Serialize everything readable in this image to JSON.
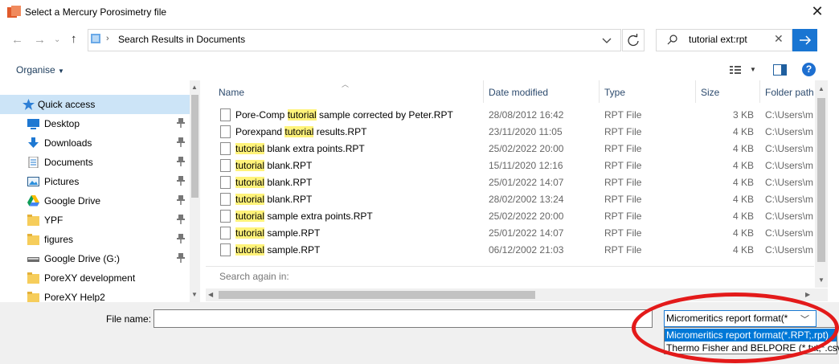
{
  "window": {
    "title": "Select a Mercury Porosimetry file"
  },
  "nav": {
    "address": "Search Results in Documents",
    "search_query": "tutorial ext:rpt"
  },
  "toolbar": {
    "organise_label": "Organise",
    "help": "?"
  },
  "sidebar": {
    "items": [
      {
        "label": "Quick access",
        "icon": "star-icon",
        "pinned": false,
        "selected": true
      },
      {
        "label": "Desktop",
        "icon": "desktop-icon",
        "pinned": true
      },
      {
        "label": "Downloads",
        "icon": "download-icon",
        "pinned": true
      },
      {
        "label": "Documents",
        "icon": "documents-icon",
        "pinned": true
      },
      {
        "label": "Pictures",
        "icon": "pictures-icon",
        "pinned": true
      },
      {
        "label": "Google Drive",
        "icon": "google-drive-icon",
        "pinned": true
      },
      {
        "label": "YPF",
        "icon": "folder-icon",
        "pinned": true
      },
      {
        "label": "figures",
        "icon": "folder-icon",
        "pinned": true
      },
      {
        "label": "Google Drive (G:)",
        "icon": "drive-icon",
        "pinned": true
      },
      {
        "label": "PoreXY development",
        "icon": "folder-icon",
        "pinned": false
      },
      {
        "label": "PoreXY Help2",
        "icon": "folder-icon",
        "pinned": false
      }
    ]
  },
  "file_list": {
    "columns": {
      "name": "Name",
      "date": "Date modified",
      "type": "Type",
      "size": "Size",
      "path": "Folder path"
    },
    "rows": [
      {
        "pre": "Pore-Comp ",
        "hl": "tutorial",
        "post": " sample corrected by Peter.RPT",
        "date": "28/08/2012 16:42",
        "type": "RPT File",
        "size": "3 KB",
        "path": "C:\\Users\\m"
      },
      {
        "pre": "Porexpand ",
        "hl": "tutorial",
        "post": " results.RPT",
        "date": "23/11/2020 11:05",
        "type": "RPT File",
        "size": "4 KB",
        "path": "C:\\Users\\m"
      },
      {
        "pre": "",
        "hl": "tutorial",
        "post": " blank extra points.RPT",
        "date": "25/02/2022 20:00",
        "type": "RPT File",
        "size": "4 KB",
        "path": "C:\\Users\\m"
      },
      {
        "pre": "",
        "hl": "tutorial",
        "post": " blank.RPT",
        "date": "15/11/2020 12:16",
        "type": "RPT File",
        "size": "4 KB",
        "path": "C:\\Users\\m"
      },
      {
        "pre": "",
        "hl": "tutorial",
        "post": " blank.RPT",
        "date": "25/01/2022 14:07",
        "type": "RPT File",
        "size": "4 KB",
        "path": "C:\\Users\\m"
      },
      {
        "pre": "",
        "hl": "tutorial",
        "post": " blank.RPT",
        "date": "28/02/2002 13:24",
        "type": "RPT File",
        "size": "4 KB",
        "path": "C:\\Users\\m"
      },
      {
        "pre": "",
        "hl": "tutorial",
        "post": " sample extra points.RPT",
        "date": "25/02/2022 20:00",
        "type": "RPT File",
        "size": "4 KB",
        "path": "C:\\Users\\m"
      },
      {
        "pre": "",
        "hl": "tutorial",
        "post": " sample.RPT",
        "date": "25/01/2022 14:07",
        "type": "RPT File",
        "size": "4 KB",
        "path": "C:\\Users\\m"
      },
      {
        "pre": "",
        "hl": "tutorial",
        "post": " sample.RPT",
        "date": "06/12/2002 21:03",
        "type": "RPT File",
        "size": "4 KB",
        "path": "C:\\Users\\m"
      }
    ],
    "search_again": "Search again in:"
  },
  "bottom": {
    "file_name_label": "File name:",
    "file_name_value": "",
    "filter_selected": "Micromeritics report format(*.RPT;.rpt)",
    "filter_options": [
      "Micromeritics report format(*.RPT;.rpt)",
      "Thermo Fisher and BELPORE (*.txt;*.csv)"
    ]
  },
  "colors": {
    "accent": "#0078d7",
    "highlight": "#fff37a",
    "annotation": "#e31a1a"
  }
}
